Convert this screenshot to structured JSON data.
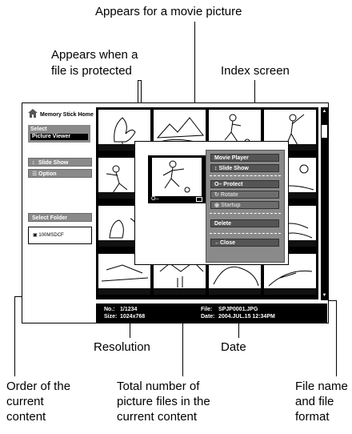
{
  "callouts": {
    "movie_picture": "Appears for a movie picture",
    "protected_1": "Appears when a",
    "protected_2": "file is protected",
    "index_screen": "Index screen",
    "resolution": "Resolution",
    "date": "Date",
    "order_1": "Order of the",
    "order_2": "current",
    "order_3": "content",
    "total_1": "Total number of",
    "total_2": "picture files in the",
    "total_3": "current content",
    "filename_1": "File name",
    "filename_2": "and file",
    "filename_3": "format"
  },
  "sidebar": {
    "home_title": "Memory Stick Home",
    "select_label": "Select",
    "picture_viewer": "Picture Viewer",
    "slide_show": "Slide Show",
    "option": "Option",
    "select_folder": "Select Folder",
    "folder_name": "100MSDCF"
  },
  "popup_menu": {
    "movie_player": "Movie Player",
    "slide_show": "Slide Show",
    "protect": "Protect",
    "rotate": "Rotate",
    "startup": "Startup",
    "delete": "Delete",
    "close": "Close"
  },
  "info": {
    "no_label": "No.:",
    "no_value": "1/1234",
    "size_label": "Size:",
    "size_value": "1024x768",
    "file_label": "File:",
    "file_value": "SPJP0001.JPG",
    "date_label": "Date:",
    "date_value": "2004.JUL.15 12:34PM"
  },
  "icons": {
    "home": "home-icon",
    "slide_show": "slideshow-icon",
    "option": "option-icon",
    "folder": "folder-icon",
    "protect": "key-icon",
    "movie": "movie-icon",
    "close": "back-arrow-icon"
  }
}
